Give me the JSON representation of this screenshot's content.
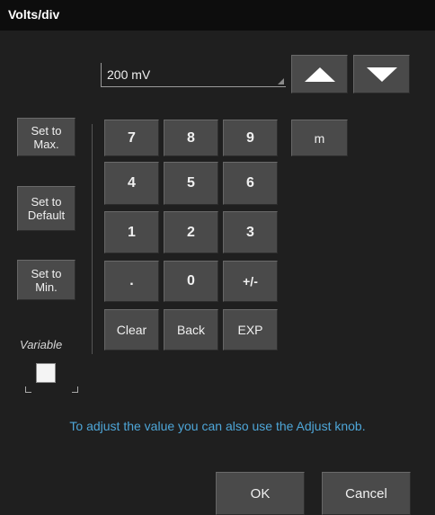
{
  "window": {
    "title": "Volts/div"
  },
  "value_field": {
    "value": "200 mV"
  },
  "increment": {
    "icon": "triangle-up-icon"
  },
  "decrement": {
    "icon": "triangle-down-icon"
  },
  "presets": {
    "max_label": "Set to Max.",
    "default_label": "Set to Default",
    "min_label": "Set to Min."
  },
  "keypad": {
    "k7": "7",
    "k8": "8",
    "k9": "9",
    "m": "m",
    "k4": "4",
    "k5": "5",
    "k6": "6",
    "k1": "1",
    "k2": "2",
    "k3": "3",
    "dot": ".",
    "k0": "0",
    "sign": "+/-",
    "clear": "Clear",
    "back": "Back",
    "exp": "EXP"
  },
  "variable": {
    "label": "Variable",
    "checked": false
  },
  "hint": "To adjust the value you can also use the Adjust knob.",
  "footer": {
    "ok_label": "OK",
    "cancel_label": "Cancel"
  },
  "colors": {
    "accent_text": "#4ea6d8",
    "button": "#4a4a4a",
    "background": "#1f1f1f"
  }
}
